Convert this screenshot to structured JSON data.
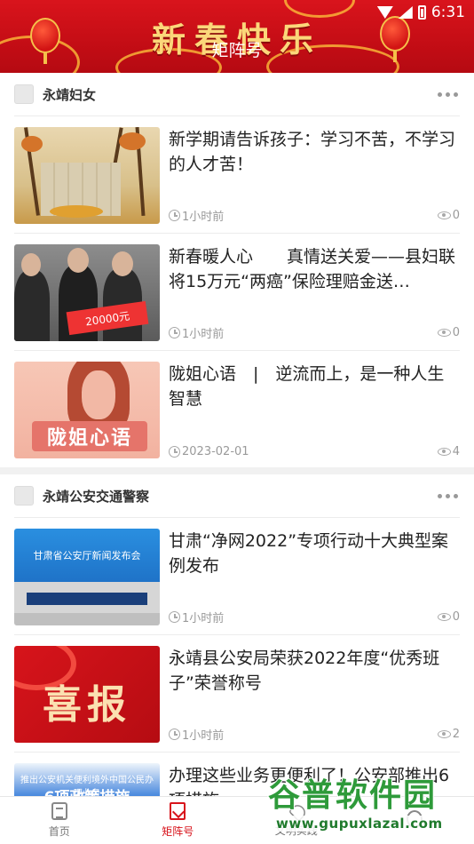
{
  "header": {
    "banner_text": "新春快乐",
    "page_title": "矩阵号",
    "status_time": "6:31"
  },
  "sections": [
    {
      "name": "永靖妇女",
      "articles": [
        {
          "title": "新学期请告诉孩子：学习不苦，不学习的人才苦！",
          "time": "1小时前",
          "views": "0"
        },
        {
          "title": "新春暖人心　　真情送关爱——县妇联将15万元“两癌”保险理赔金送…",
          "time": "1小时前",
          "views": "0"
        },
        {
          "title": "陇姐心语　|　逆流而上，是一种人生智慧",
          "time": "2023-02-01",
          "views": "4"
        }
      ]
    },
    {
      "name": "永靖公安交通警察",
      "articles": [
        {
          "title": "甘肃“净网2022”专项行动十大典型案例发布",
          "time": "1小时前",
          "views": "0"
        },
        {
          "title": "永靖县公安局荣获2022年度“优秀班子”荣誉称号",
          "time": "1小时前",
          "views": "2"
        },
        {
          "title": "办理这些业务更便利了！公安部推出6项措施",
          "time": "",
          "views": ""
        }
      ]
    }
  ],
  "thumb_text": {
    "t2_board": "20000元",
    "t3_label": "陇姐心语",
    "t4_caption": "甘肃省公安厅新闻发布会",
    "t5_text": "喜报",
    "t6_line1": "推出公安机关便利境外中国公民办理业务",
    "t6_line2": "6项政策措施"
  },
  "bottom_nav": {
    "items": [
      {
        "label": "首页",
        "icon": "home-icon",
        "active": false
      },
      {
        "label": "矩阵号",
        "icon": "matrix-icon",
        "active": true
      },
      {
        "label": "文明实践",
        "icon": "civil-icon",
        "active": false
      },
      {
        "label": "",
        "icon": "mine-icon",
        "active": false
      }
    ]
  },
  "watermark": {
    "text": "谷普软件园",
    "url": "www.gupuxlazal.com"
  },
  "colors": {
    "accent": "#d8141c",
    "banner_gold": "#fbd77a",
    "meta_gray": "#9a9a9a"
  }
}
